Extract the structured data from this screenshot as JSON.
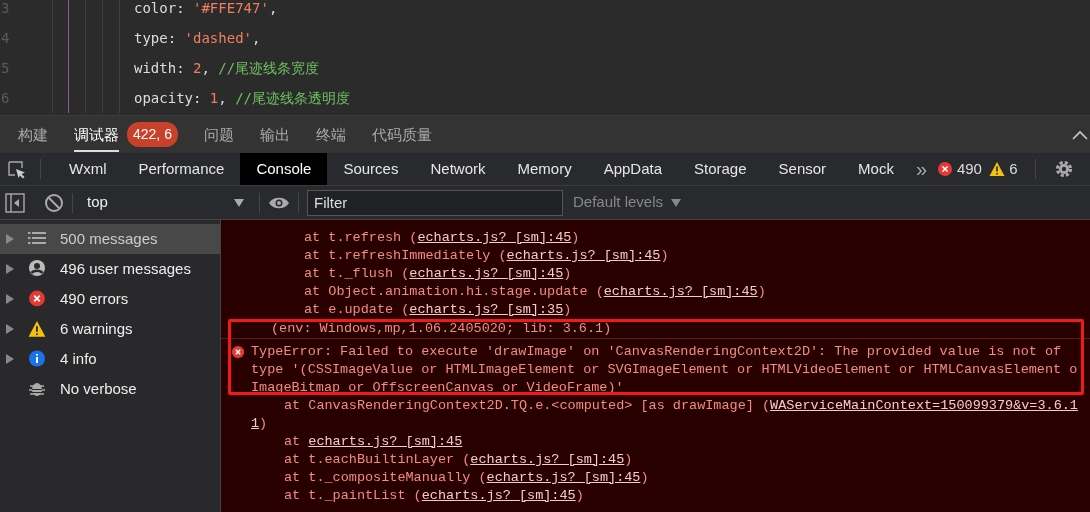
{
  "editor": {
    "lines": [
      {
        "number": "3",
        "tokens": [
          {
            "kind": "plain",
            "text": "color: "
          },
          {
            "kind": "string",
            "text": "'#FFE747'"
          },
          {
            "kind": "plain",
            "text": ","
          }
        ]
      },
      {
        "number": "4",
        "tokens": [
          {
            "kind": "plain",
            "text": "type: "
          },
          {
            "kind": "string",
            "text": "'dashed'"
          },
          {
            "kind": "plain",
            "text": ","
          }
        ]
      },
      {
        "number": "5",
        "tokens": [
          {
            "kind": "plain",
            "text": "width: "
          },
          {
            "kind": "number",
            "text": "2"
          },
          {
            "kind": "plain",
            "text": ", "
          },
          {
            "kind": "comment",
            "text": "//尾迹线条宽度"
          }
        ]
      },
      {
        "number": "6",
        "tokens": [
          {
            "kind": "plain",
            "text": "opacity: "
          },
          {
            "kind": "number",
            "text": "1"
          },
          {
            "kind": "plain",
            "text": ", "
          },
          {
            "kind": "comment",
            "text": "//尾迹线条透明度"
          }
        ]
      }
    ]
  },
  "panel_tabs": [
    {
      "label": "构建",
      "selected": false
    },
    {
      "label": "调试器",
      "selected": true,
      "badge": "422, 6"
    },
    {
      "label": "问题",
      "selected": false
    },
    {
      "label": "输出",
      "selected": false
    },
    {
      "label": "终端",
      "selected": false
    },
    {
      "label": "代码质量",
      "selected": false
    }
  ],
  "devtools_tabs": [
    {
      "label": "Wxml",
      "selected": false
    },
    {
      "label": "Performance",
      "selected": false
    },
    {
      "label": "Console",
      "selected": true
    },
    {
      "label": "Sources",
      "selected": false
    },
    {
      "label": "Network",
      "selected": false
    },
    {
      "label": "Memory",
      "selected": false
    },
    {
      "label": "AppData",
      "selected": false
    },
    {
      "label": "Storage",
      "selected": false
    },
    {
      "label": "Sensor",
      "selected": false
    },
    {
      "label": "Mock",
      "selected": false
    }
  ],
  "overflow": "»",
  "counts": {
    "errors": "490",
    "warnings": "6"
  },
  "toolbar": {
    "context": "top",
    "filter_placeholder": "Filter",
    "levels": "Default levels"
  },
  "sidebar": {
    "items": [
      {
        "kind": "all",
        "label": "500 messages",
        "selected": true,
        "expandable": true
      },
      {
        "kind": "user",
        "label": "496 user messages",
        "selected": false,
        "expandable": true
      },
      {
        "kind": "error",
        "label": "490 errors",
        "selected": false,
        "expandable": true
      },
      {
        "kind": "warning",
        "label": "6 warnings",
        "selected": false,
        "expandable": true
      },
      {
        "kind": "info",
        "label": "4 info",
        "selected": false,
        "expandable": true
      },
      {
        "kind": "verbose",
        "label": "No verbose",
        "selected": false,
        "expandable": false
      }
    ]
  },
  "console": {
    "lines": [
      {
        "kind": "trace_deep",
        "parts": [
          {
            "text": "at t.refresh ("
          },
          {
            "text": "echarts.js? [sm]:45",
            "link": true
          },
          {
            "text": ")"
          }
        ]
      },
      {
        "kind": "trace_deep",
        "parts": [
          {
            "text": "at t.refreshImmediately ("
          },
          {
            "text": "echarts.js? [sm]:45",
            "link": true
          },
          {
            "text": ")"
          }
        ]
      },
      {
        "kind": "trace_deep",
        "parts": [
          {
            "text": "at t._flush ("
          },
          {
            "text": "echarts.js? [sm]:45",
            "link": true
          },
          {
            "text": ")"
          }
        ]
      },
      {
        "kind": "trace_deep",
        "parts": [
          {
            "text": "at Object.animation.hi.stage.update ("
          },
          {
            "text": "echarts.js? [sm]:45",
            "link": true
          },
          {
            "text": ")"
          }
        ]
      },
      {
        "kind": "trace_deep",
        "parts": [
          {
            "text": "at e.update ("
          },
          {
            "text": "echarts.js? [sm]:35",
            "link": true
          },
          {
            "text": ")"
          }
        ]
      },
      {
        "kind": "env",
        "parts": [
          {
            "text": "(env: Windows,mp,1.06.2405020; lib: 3.6.1)"
          }
        ]
      },
      {
        "kind": "error",
        "parts": [
          {
            "text": "TypeError: Failed to execute 'drawImage' on 'CanvasRenderingContext2D': The provided value is not of"
          }
        ]
      },
      {
        "kind": "wrap",
        "parts": [
          {
            "text": "type '(CSSImageValue or HTMLImageElement or SVGImageElement or HTMLVideoElement or HTMLCanvasElement o"
          }
        ]
      },
      {
        "kind": "wrap",
        "parts": [
          {
            "text": "ImageBitmap or OffscreenCanvas or VideoFrame)'"
          }
        ]
      },
      {
        "kind": "trace",
        "parts": [
          {
            "text": "at CanvasRenderingContext2D.TQ.e.<computed> [as drawImage] ("
          },
          {
            "text": "WAServiceMainContext=150099379&v=3.6.1",
            "link": true
          }
        ]
      },
      {
        "kind": "wrap",
        "parts": [
          {
            "text": "1",
            "link": true
          },
          {
            "text": ")"
          }
        ]
      },
      {
        "kind": "trace",
        "parts": [
          {
            "text": "at "
          },
          {
            "text": "echarts.js? [sm]:45",
            "link": true
          }
        ]
      },
      {
        "kind": "trace",
        "parts": [
          {
            "text": "at t.eachBuiltinLayer ("
          },
          {
            "text": "echarts.js? [sm]:45",
            "link": true
          },
          {
            "text": ")"
          }
        ]
      },
      {
        "kind": "trace",
        "parts": [
          {
            "text": "at t._compositeManually ("
          },
          {
            "text": "echarts.js? [sm]:45",
            "link": true
          },
          {
            "text": ")"
          }
        ]
      },
      {
        "kind": "trace",
        "parts": [
          {
            "text": "at t._paintList ("
          },
          {
            "text": "echarts.js? [sm]:45",
            "link": true
          },
          {
            "text": ")"
          }
        ]
      }
    ]
  }
}
